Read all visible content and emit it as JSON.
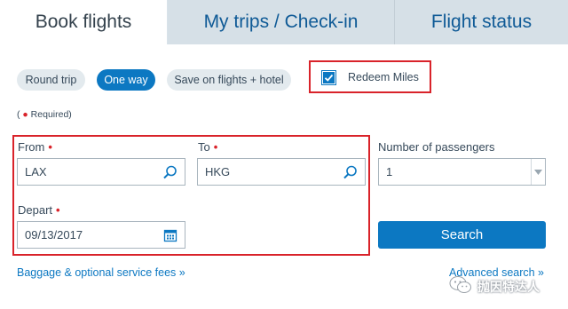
{
  "tabs": [
    {
      "label": "Book flights",
      "active": true
    },
    {
      "label": "My trips / Check-in",
      "active": false
    },
    {
      "label": "Flight status",
      "active": false
    }
  ],
  "trip_types": [
    {
      "label": "Round trip",
      "active": false
    },
    {
      "label": "One way",
      "active": true
    },
    {
      "label": "Save on flights + hotel",
      "active": false
    }
  ],
  "redeem_miles": {
    "label": "Redeem Miles",
    "checked": true
  },
  "required_note": {
    "open": "(",
    "close": " Required)"
  },
  "from": {
    "label": "From",
    "value": "LAX",
    "icon": "search-icon"
  },
  "to": {
    "label": "To",
    "value": "HKG",
    "icon": "search-icon"
  },
  "depart": {
    "label": "Depart",
    "value": "09/13/2017",
    "icon": "calendar-icon"
  },
  "passengers": {
    "label": "Number of passengers",
    "value": "1"
  },
  "search_button": "Search",
  "links": {
    "baggage": "Baggage & optional service fees »",
    "advanced": "Advanced search »"
  },
  "watermark": "抛因特达人",
  "colors": {
    "accent": "#0c78c2",
    "highlight": "#d9232a",
    "required": "#d9232a"
  }
}
